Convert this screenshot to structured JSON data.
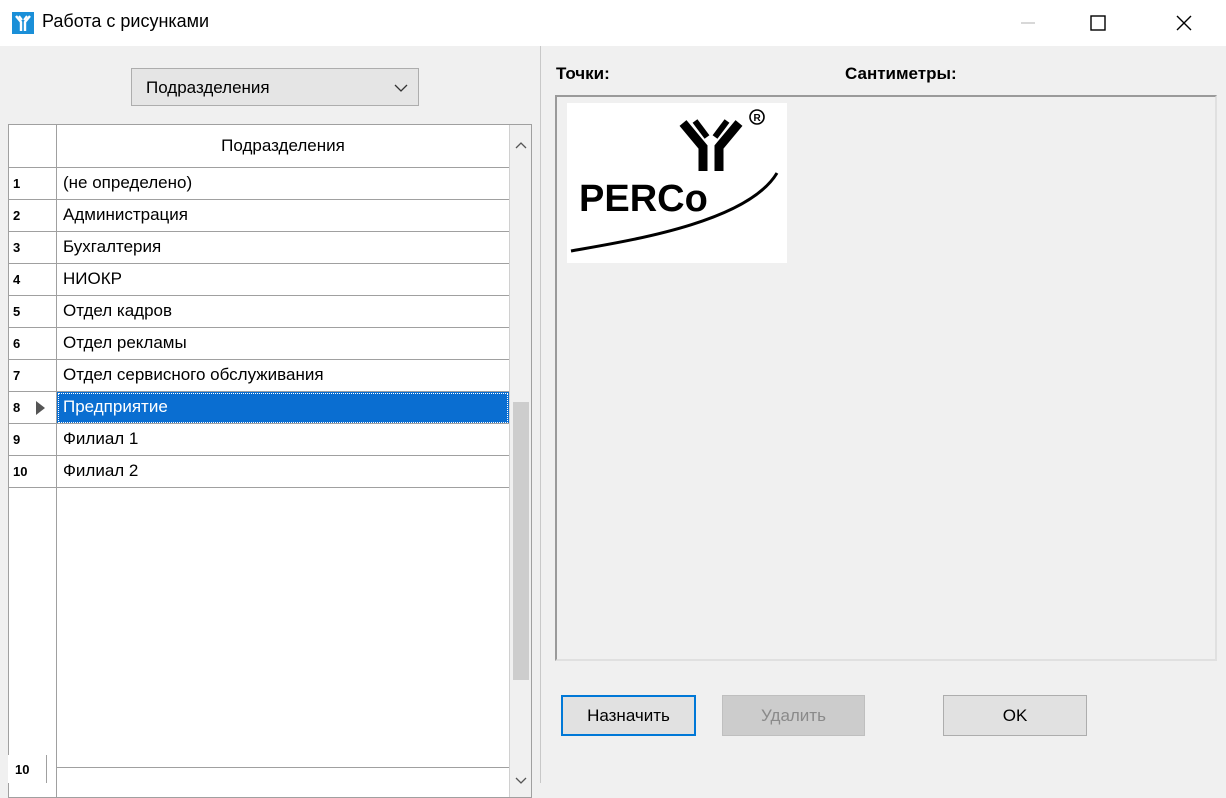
{
  "window": {
    "title": "Работа с рисунками",
    "app_icon": "perco-icon",
    "controls": {
      "minimize": "minimize-icon",
      "maximize": "maximize-icon",
      "close": "close-icon"
    }
  },
  "left": {
    "combo": {
      "value": "Подразделения"
    },
    "grid": {
      "header": "Подразделения",
      "rows": [
        {
          "num": "1",
          "name": "(не определено)"
        },
        {
          "num": "2",
          "name": "Администрация"
        },
        {
          "num": "3",
          "name": "Бухгалтерия"
        },
        {
          "num": "4",
          "name": "НИОКР"
        },
        {
          "num": "5",
          "name": "Отдел кадров"
        },
        {
          "num": "6",
          "name": "Отдел рекламы"
        },
        {
          "num": "7",
          "name": "Отдел сервисного обслуживания"
        },
        {
          "num": "8",
          "name": "Предприятие",
          "selected": true
        },
        {
          "num": "9",
          "name": "Филиал 1"
        },
        {
          "num": "10",
          "name": "Филиал 2"
        }
      ]
    },
    "record_count": "10"
  },
  "right": {
    "label_points": "Точки:",
    "label_cm": "Сантиметры:",
    "image": {
      "logo_text": "PERCo"
    },
    "buttons": {
      "assign": "Назначить",
      "delete": "Удалить",
      "ok": "OK"
    }
  },
  "colors": {
    "selection": "#0a6ed1",
    "focus_border": "#0078d7",
    "background": "#f0f0f0"
  }
}
